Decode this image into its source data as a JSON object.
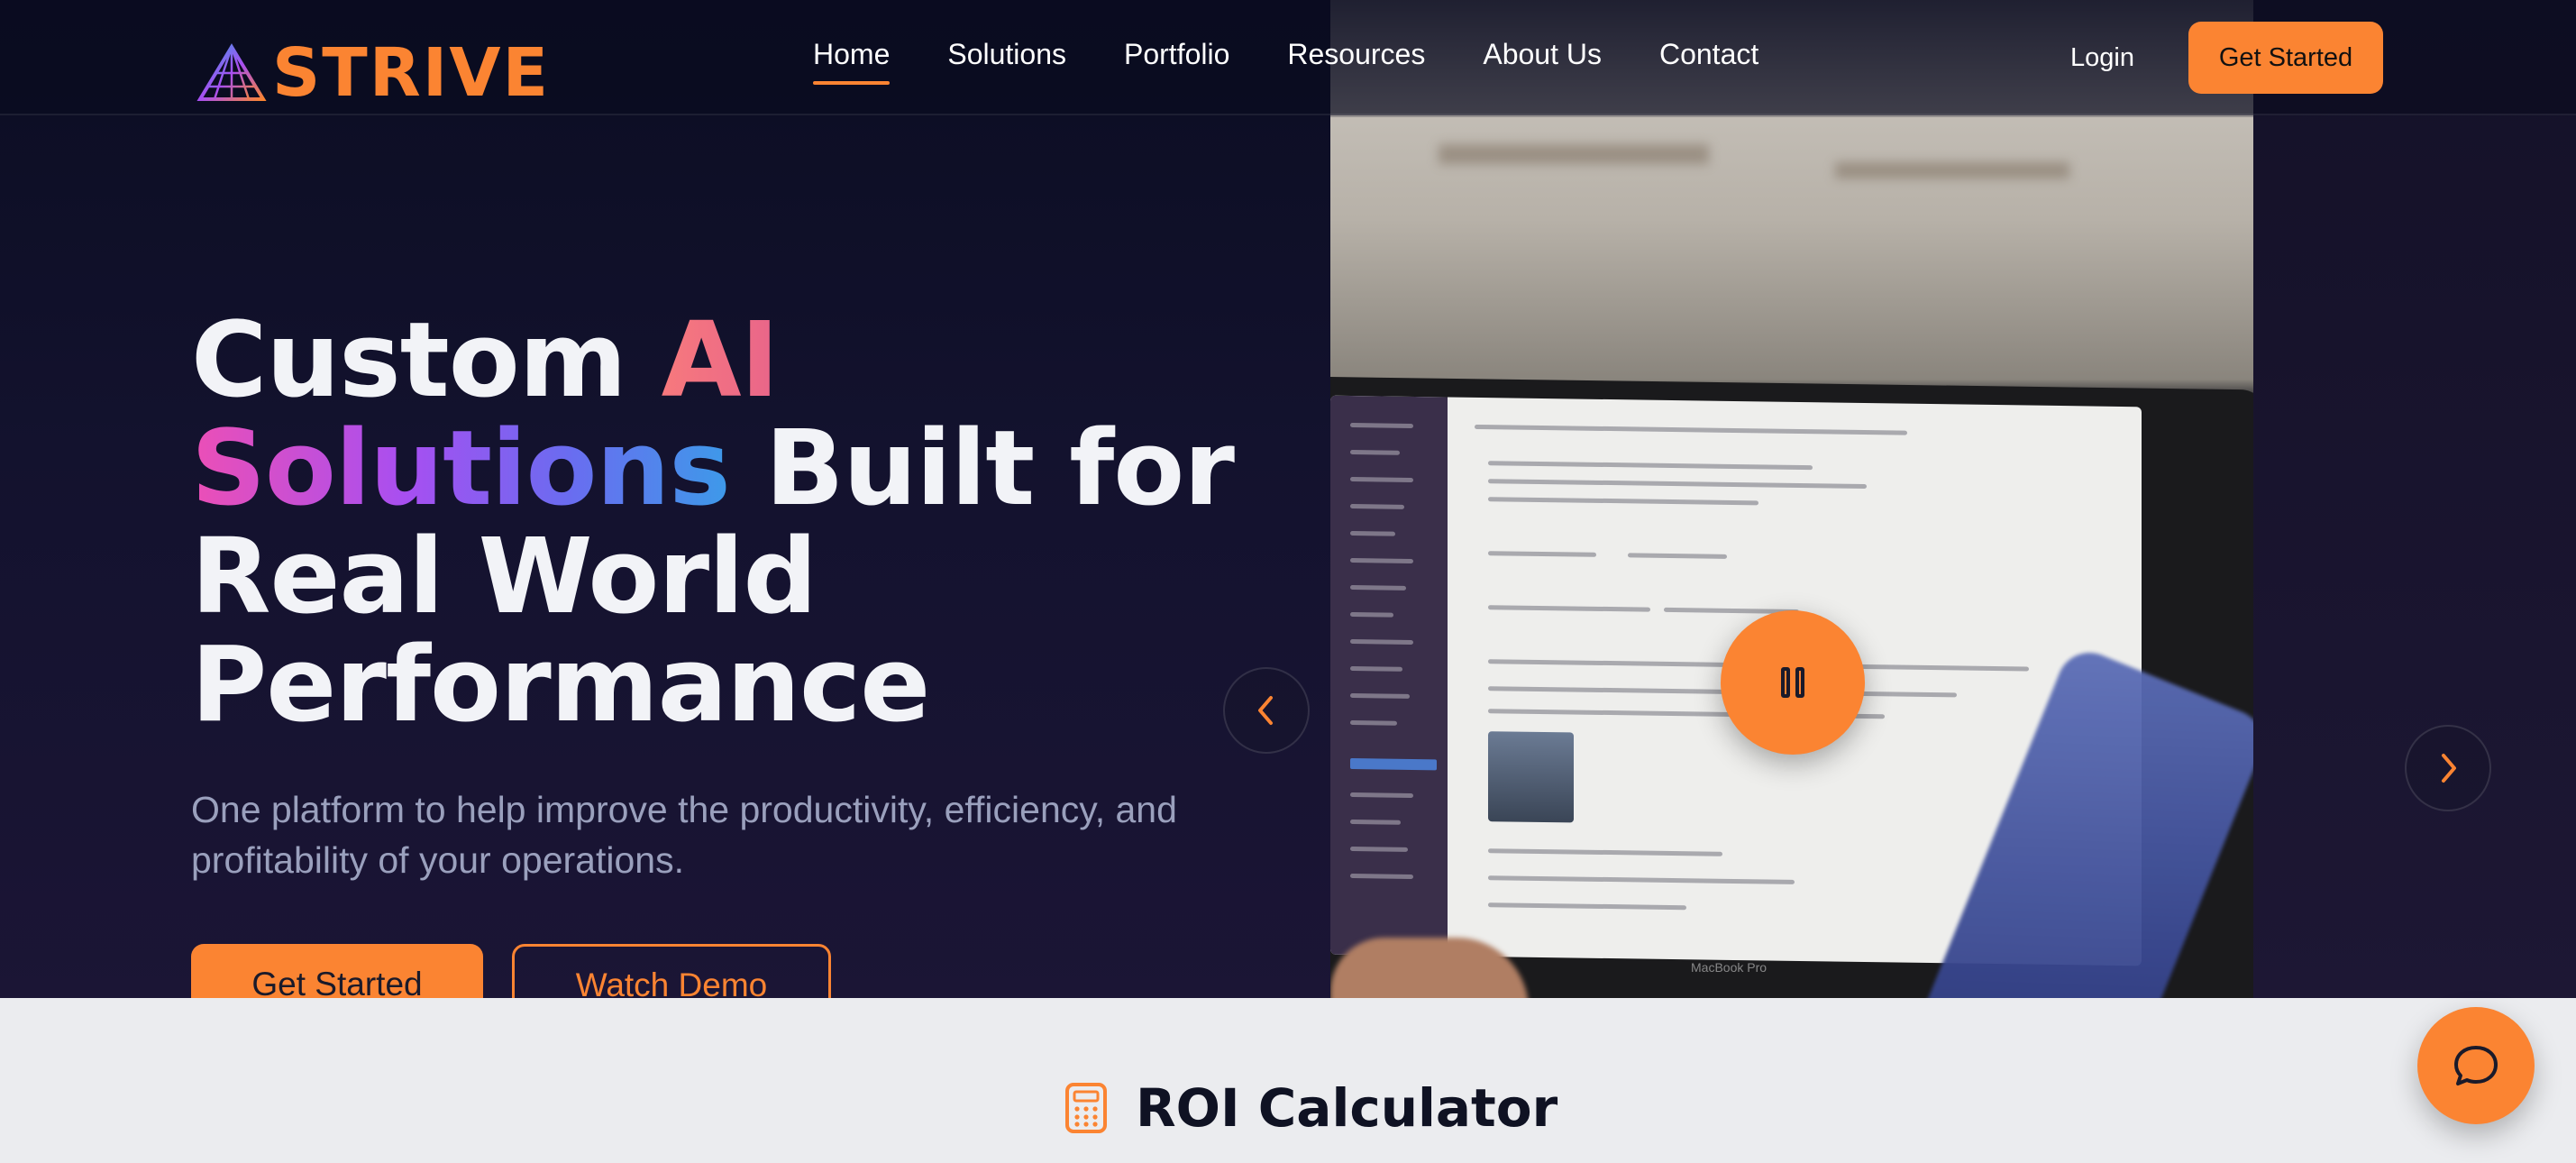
{
  "brand": {
    "name": "STRIVE"
  },
  "nav": {
    "links": [
      {
        "label": "Home",
        "active": true
      },
      {
        "label": "Solutions"
      },
      {
        "label": "Portfolio"
      },
      {
        "label": "Resources"
      },
      {
        "label": "About Us"
      },
      {
        "label": "Contact"
      }
    ],
    "login_label": "Login",
    "cta_label": "Get Started"
  },
  "hero": {
    "headline": {
      "part1": "Custom ",
      "highlight1": "AI",
      "highlight2": "Solutions",
      "part2": " Built for",
      "line3": "Real World",
      "line4": "Performance"
    },
    "subtitle": "One platform to help improve the productivity, efficiency, and profitability of your operations.",
    "primary_button": "Get Started",
    "secondary_button": "Watch Demo",
    "media": {
      "brand_label": "MacBook Pro",
      "controls": {
        "pause": "pause-icon",
        "prev": "chevron-left-icon",
        "next": "chevron-right-icon"
      }
    }
  },
  "roi": {
    "title": "ROI Calculator",
    "icon": "calculator-icon"
  },
  "chat": {
    "icon": "chat-bubble-icon"
  },
  "colors": {
    "accent": "#fb8432",
    "hero_bg": "#0b0d22",
    "section_bg": "#ebecef",
    "heading_dark": "#0f1223",
    "gradient_ai": [
      "#f7797d",
      "#e9658a"
    ],
    "gradient_solutions": [
      "#ec4fb6",
      "#a74ff1",
      "#6a6cf0",
      "#3d9ae9"
    ]
  }
}
